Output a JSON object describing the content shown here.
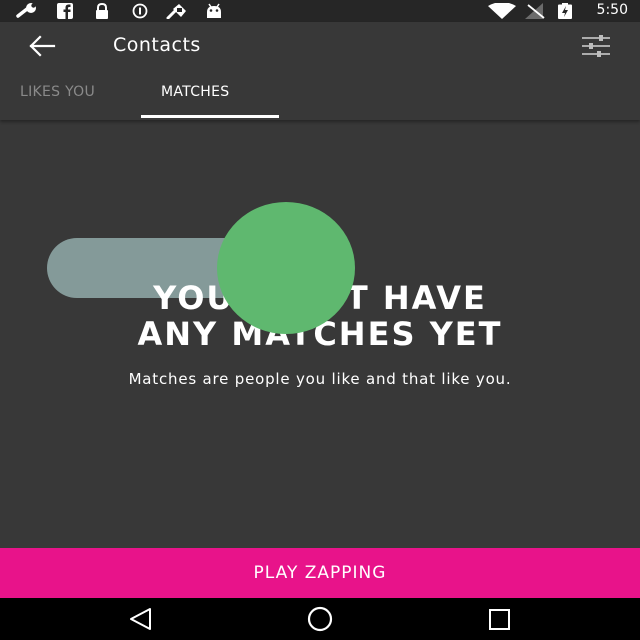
{
  "status_bar": {
    "time": "5:50",
    "icons": [
      "wrench-icon",
      "facebook-icon",
      "lock-icon",
      "data-saver-icon",
      "pin-icon",
      "android-icon",
      "wifi-icon",
      "signal-icon",
      "battery-icon"
    ]
  },
  "app_bar": {
    "title": "Contacts",
    "back_icon": "arrow-back-icon",
    "filter_icon": "filter-sliders-icon"
  },
  "tabs": [
    {
      "label": "LIKES YOU",
      "selected": false
    },
    {
      "label": "MATCHES",
      "selected": true
    }
  ],
  "empty_state": {
    "headline_line1": "YOU DON'T HAVE",
    "headline_line2": "ANY MATCHES YET",
    "subtext": "Matches are people you like and that like you."
  },
  "cta": {
    "label": "PLAY ZAPPING"
  },
  "colors": {
    "background": "#383838",
    "accent": "#e8138a",
    "knob": "#5fb86f",
    "track": "#849a99"
  },
  "nav_bar": {
    "icons": [
      "back-triangle-icon",
      "home-circle-icon",
      "recents-square-icon"
    ]
  }
}
